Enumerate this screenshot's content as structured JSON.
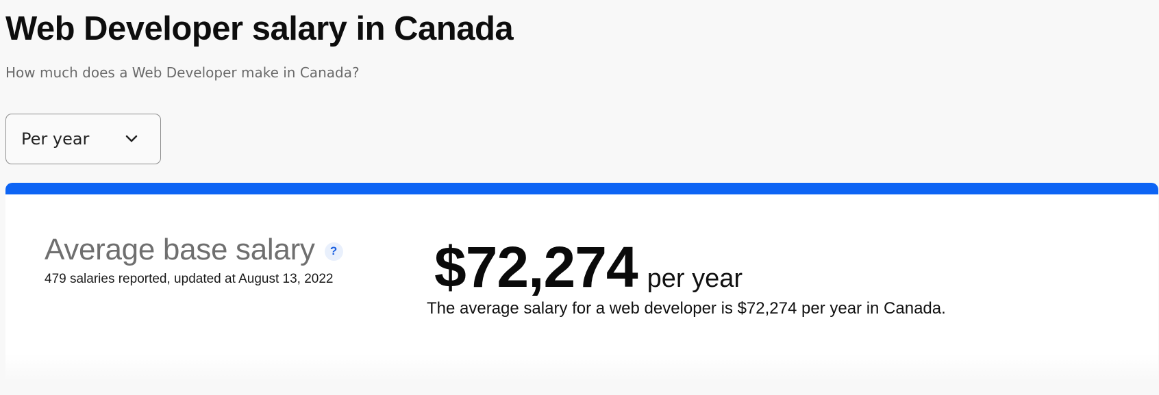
{
  "header": {
    "title": "Web Developer salary in Canada",
    "subtitle": "How much does a Web Developer make in Canada?"
  },
  "period_select": {
    "selected": "Per year",
    "icon": "chevron-down-icon"
  },
  "salary_card": {
    "accent_color": "#0d64f4",
    "heading": "Average base salary",
    "help_icon": "?",
    "report_meta": "479 salaries reported, updated at August 13, 2022",
    "amount": "$72,274",
    "period": "per year",
    "summary": "The average salary for a web developer is $72,274 per year in Canada."
  }
}
